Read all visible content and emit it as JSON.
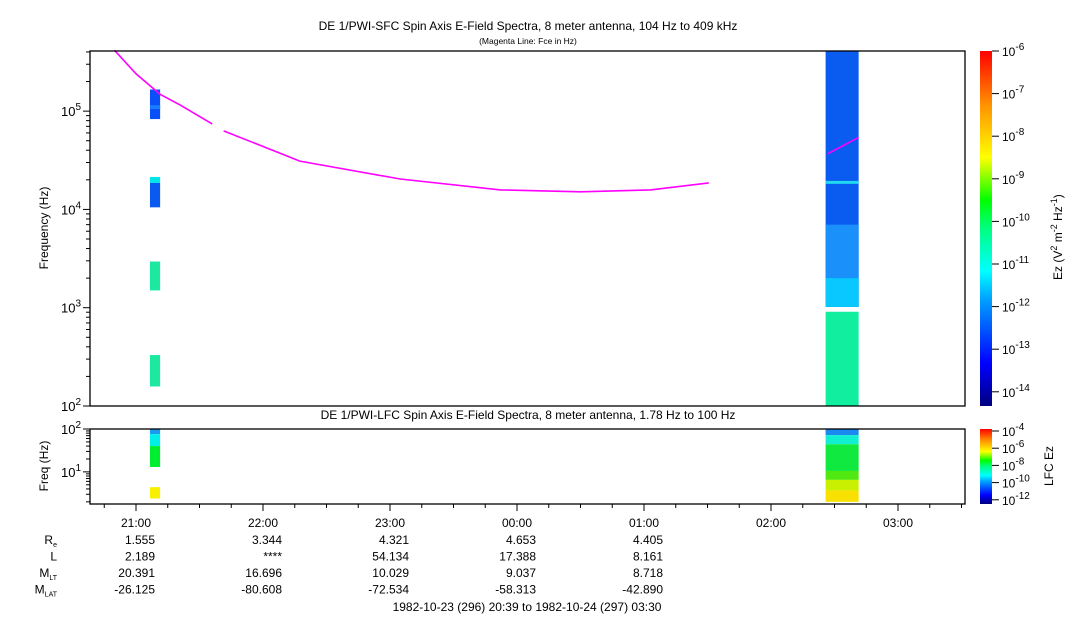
{
  "chart_data": [
    {
      "type": "heatmap",
      "title": "DE 1/PWI-SFC  Spin Axis E-Field Spectra, 8 meter antenna, 104 Hz to 409 kHz",
      "subtitle": "(Magenta Line: Fce in Hz)",
      "ylabel": "Frequency (Hz)",
      "yscale": "log",
      "ylim": [
        100,
        409000
      ],
      "xlim_hours": [
        20.65,
        27.5
      ],
      "y_ticks": [
        {
          "base": "10",
          "exp": "5",
          "value": 100000
        },
        {
          "base": "10",
          "exp": "4",
          "value": 10000
        },
        {
          "base": "10",
          "exp": "3",
          "value": 1000
        },
        {
          "base": "10",
          "exp": "2",
          "value": 100
        }
      ],
      "colorbar": {
        "label": "Ez (V",
        "label_sup1": "2",
        "label_mid": " m",
        "label_sup2": "-2",
        "label_mid2": " Hz",
        "label_sup3": "-1",
        "label_end": ")",
        "ticks": [
          {
            "base": "10",
            "exp": "-6"
          },
          {
            "base": "10",
            "exp": "-7"
          },
          {
            "base": "10",
            "exp": "-8"
          },
          {
            "base": "10",
            "exp": "-9"
          },
          {
            "base": "10",
            "exp": "-10"
          },
          {
            "base": "10",
            "exp": "-11"
          },
          {
            "base": "10",
            "exp": "-12"
          },
          {
            "base": "10",
            "exp": "-13"
          },
          {
            "base": "10",
            "exp": "-14"
          }
        ],
        "range_log10": [
          -14.4,
          -6
        ]
      },
      "blocks": [
        {
          "t": [
            21.11,
            21.19
          ],
          "f": [
            83000,
            166000
          ],
          "color": "#0a50f8"
        },
        {
          "t": [
            21.11,
            21.19
          ],
          "f": [
            105000,
            115000
          ],
          "color": "#1a7cff"
        },
        {
          "t": [
            21.11,
            21.19
          ],
          "f": [
            18600,
            21400
          ],
          "color": "#00e5e8"
        },
        {
          "t": [
            21.11,
            21.19
          ],
          "f": [
            10500,
            18600
          ],
          "color": "#0a5af0"
        },
        {
          "t": [
            21.11,
            21.19
          ],
          "f": [
            1500,
            2950
          ],
          "color": "#1de8a0"
        },
        {
          "t": [
            21.11,
            21.19
          ],
          "f": [
            158,
            330
          ],
          "color": "#1de8a0"
        },
        {
          "t": [
            26.43,
            26.69
          ],
          "f": [
            1020,
            409000
          ],
          "color": "#0a5cf0"
        },
        {
          "t": [
            26.43,
            26.69
          ],
          "f": [
            1020,
            7000
          ],
          "color": "#1a90fa"
        },
        {
          "t": [
            26.43,
            26.69
          ],
          "f": [
            1020,
            2000
          ],
          "color": "#08c8ff"
        },
        {
          "t": [
            26.43,
            26.69
          ],
          "f": [
            18200,
            19500
          ],
          "color": "#20d8f0"
        },
        {
          "t": [
            26.43,
            26.69
          ],
          "f": [
            100,
            910
          ],
          "color": "#12eea0"
        }
      ],
      "fce_line": {
        "color": "#ff00ff",
        "segments": [
          [
            [
              20.83,
              417000
            ],
            [
              21.0,
              240000
            ],
            [
              21.19,
              148000
            ],
            [
              21.35,
              115000
            ],
            [
              21.6,
              74000
            ]
          ],
          [
            [
              21.69,
              63000
            ],
            [
              22.29,
              31000
            ],
            [
              23.08,
              20400
            ],
            [
              23.87,
              15800
            ],
            [
              24.5,
              15100
            ],
            [
              25.05,
              15800
            ],
            [
              25.51,
              18600
            ]
          ],
          [
            [
              26.45,
              37000
            ],
            [
              26.69,
              54000
            ]
          ]
        ]
      }
    },
    {
      "type": "heatmap",
      "title": "DE 1/PWI-LFC  Spin Axis E-Field Spectra, 8 meter antenna, 1.78 Hz to 100 Hz",
      "ylabel": "Freq (Hz)",
      "yscale": "log",
      "ylim": [
        1.78,
        100
      ],
      "y_ticks": [
        {
          "base": "10",
          "exp": "2",
          "value": 100
        },
        {
          "base": "10",
          "exp": "1",
          "value": 10
        }
      ],
      "colorbar": {
        "label": "LFC Ez",
        "ticks": [
          {
            "base": "10",
            "exp": "-4"
          },
          {
            "base": "10",
            "exp": "-6"
          },
          {
            "base": "10",
            "exp": "-8"
          },
          {
            "base": "10",
            "exp": "-10"
          },
          {
            "base": "10",
            "exp": "-12"
          }
        ],
        "range_log10": [
          -12.2,
          -3.8
        ]
      },
      "blocks": [
        {
          "t": [
            21.11,
            21.19
          ],
          "f": [
            76,
            100
          ],
          "color": "#1a9af0"
        },
        {
          "t": [
            21.11,
            21.19
          ],
          "f": [
            40,
            76
          ],
          "color": "#00f0e8"
        },
        {
          "t": [
            21.11,
            21.19
          ],
          "f": [
            13,
            40
          ],
          "color": "#00ee30"
        },
        {
          "t": [
            21.11,
            21.19
          ],
          "f": [
            2.4,
            4.4
          ],
          "color": "#f8f000"
        },
        {
          "t": [
            26.43,
            26.69
          ],
          "f": [
            72,
            100
          ],
          "color": "#1a8af0"
        },
        {
          "t": [
            26.43,
            26.69
          ],
          "f": [
            44,
            72
          ],
          "color": "#10f0d0"
        },
        {
          "t": [
            26.43,
            26.69
          ],
          "f": [
            10.5,
            44
          ],
          "color": "#10ea40"
        },
        {
          "t": [
            26.43,
            26.69
          ],
          "f": [
            6.5,
            10.5
          ],
          "color": "#50e810"
        },
        {
          "t": [
            26.43,
            26.69
          ],
          "f": [
            3.7,
            6.5
          ],
          "color": "#c8f000"
        },
        {
          "t": [
            26.43,
            26.69
          ],
          "f": [
            2.0,
            3.7
          ],
          "color": "#f8e000"
        }
      ]
    }
  ],
  "x_axis": {
    "ticks": [
      {
        "label": "21:00",
        "hours": 21
      },
      {
        "label": "22:00",
        "hours": 22
      },
      {
        "label": "23:00",
        "hours": 23
      },
      {
        "label": "00:00",
        "hours": 24
      },
      {
        "label": "01:00",
        "hours": 25
      },
      {
        "label": "02:00",
        "hours": 26
      },
      {
        "label": "03:00",
        "hours": 27
      }
    ]
  },
  "ephemeris": {
    "rows": [
      {
        "label": "R",
        "sub": "e",
        "values": [
          "1.555",
          "3.344",
          "4.321",
          "4.653",
          "4.405"
        ]
      },
      {
        "label": "L",
        "sub": "",
        "values": [
          "2.189",
          "****",
          "54.134",
          "17.388",
          "8.161"
        ]
      },
      {
        "label": "M",
        "sub": "LT",
        "values": [
          "20.391",
          "16.696",
          "10.029",
          "9.037",
          "8.718"
        ]
      },
      {
        "label": "M",
        "sub": "LAT",
        "values": [
          "-26.125",
          "-80.608",
          "-72.534",
          "-58.313",
          "-42.890"
        ]
      }
    ],
    "time_range": "1982-10-23 (296) 20:39 to 1982-10-24 (297) 03:30"
  }
}
